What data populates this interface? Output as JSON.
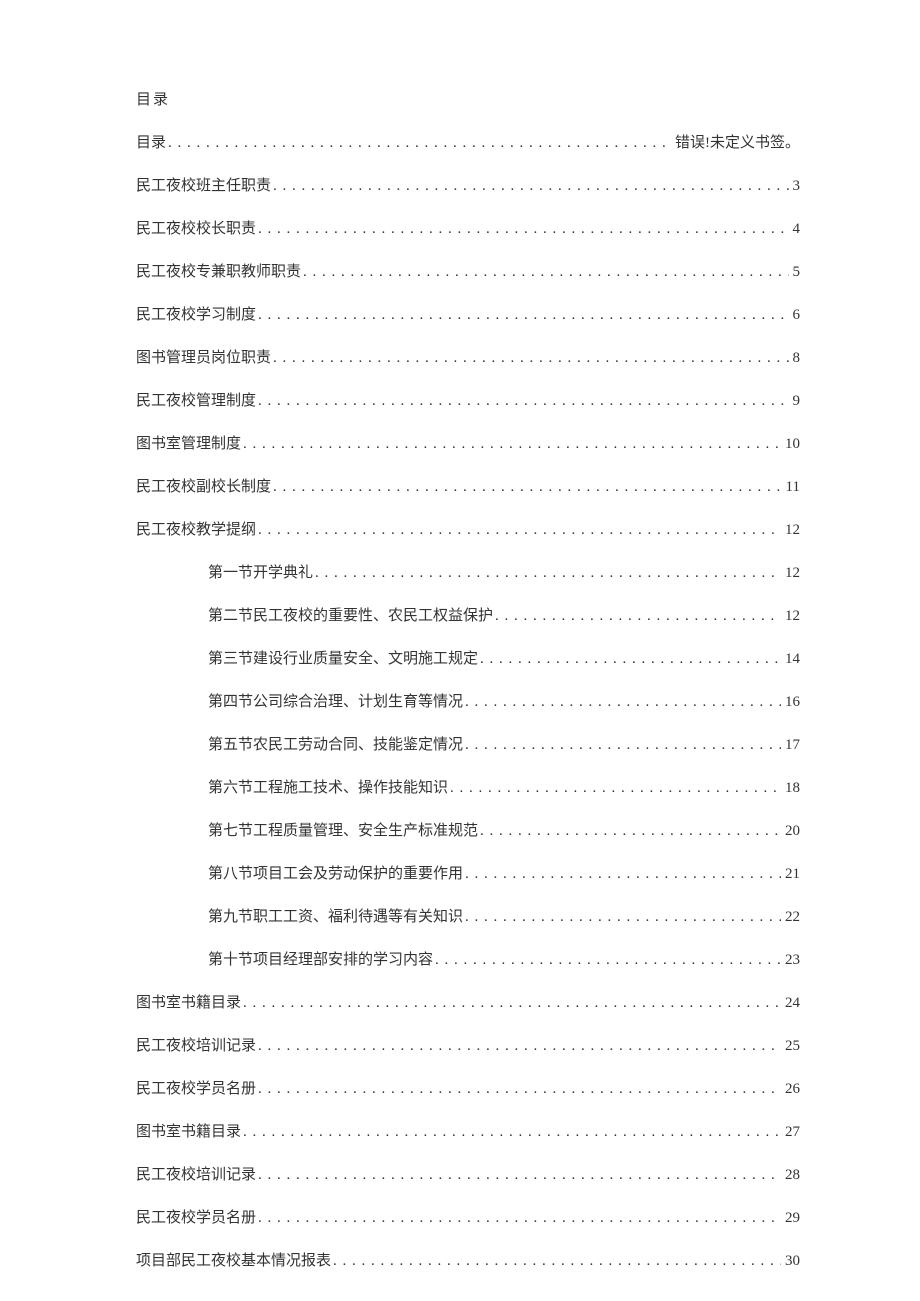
{
  "title": "目录",
  "entries": [
    {
      "label": "目录",
      "page": "错误!未定义书签。",
      "indent": 0
    },
    {
      "label": "民工夜校班主任职责",
      "page": "3",
      "indent": 0
    },
    {
      "label": "民工夜校校长职责",
      "page": "4",
      "indent": 0
    },
    {
      "label": "民工夜校专兼职教师职责",
      "page": "5",
      "indent": 0
    },
    {
      "label": "民工夜校学习制度",
      "page": "6",
      "indent": 0
    },
    {
      "label": "图书管理员岗位职责",
      "page": "8",
      "indent": 0
    },
    {
      "label": "民工夜校管理制度",
      "page": "9",
      "indent": 0
    },
    {
      "label": "图书室管理制度",
      "page": "10",
      "indent": 0
    },
    {
      "label": "民工夜校副校长制度",
      "page": "11",
      "indent": 0
    },
    {
      "label": "民工夜校教学提纲",
      "page": "12",
      "indent": 0
    },
    {
      "label": "第一节开学典礼",
      "page": "12",
      "indent": 1
    },
    {
      "label": "第二节民工夜校的重要性、农民工权益保护",
      "page": "12",
      "indent": 1
    },
    {
      "label": "第三节建设行业质量安全、文明施工规定",
      "page": "14",
      "indent": 1
    },
    {
      "label": "第四节公司综合治理、计划生育等情况",
      "page": "16",
      "indent": 1
    },
    {
      "label": "第五节农民工劳动合同、技能鉴定情况",
      "page": "17",
      "indent": 1
    },
    {
      "label": "第六节工程施工技术、操作技能知识",
      "page": "18",
      "indent": 1
    },
    {
      "label": "第七节工程质量管理、安全生产标准规范",
      "page": "20",
      "indent": 1
    },
    {
      "label": "第八节项目工会及劳动保护的重要作用",
      "page": "21",
      "indent": 1
    },
    {
      "label": "第九节职工工资、福利待遇等有关知识",
      "page": "22",
      "indent": 1
    },
    {
      "label": "第十节项目经理部安排的学习内容",
      "page": "23",
      "indent": 1
    },
    {
      "label": "图书室书籍目录",
      "page": "24",
      "indent": 0
    },
    {
      "label": "民工夜校培训记录",
      "page": "25",
      "indent": 0
    },
    {
      "label": "民工夜校学员名册",
      "page": "26",
      "indent": 0
    },
    {
      "label": "图书室书籍目录",
      "page": "27",
      "indent": 0
    },
    {
      "label": "民工夜校培训记录",
      "page": "28",
      "indent": 0
    },
    {
      "label": "民工夜校学员名册",
      "page": "29",
      "indent": 0
    },
    {
      "label": "项目部民工夜校基本情况报表",
      "page": "30",
      "indent": 0
    }
  ]
}
